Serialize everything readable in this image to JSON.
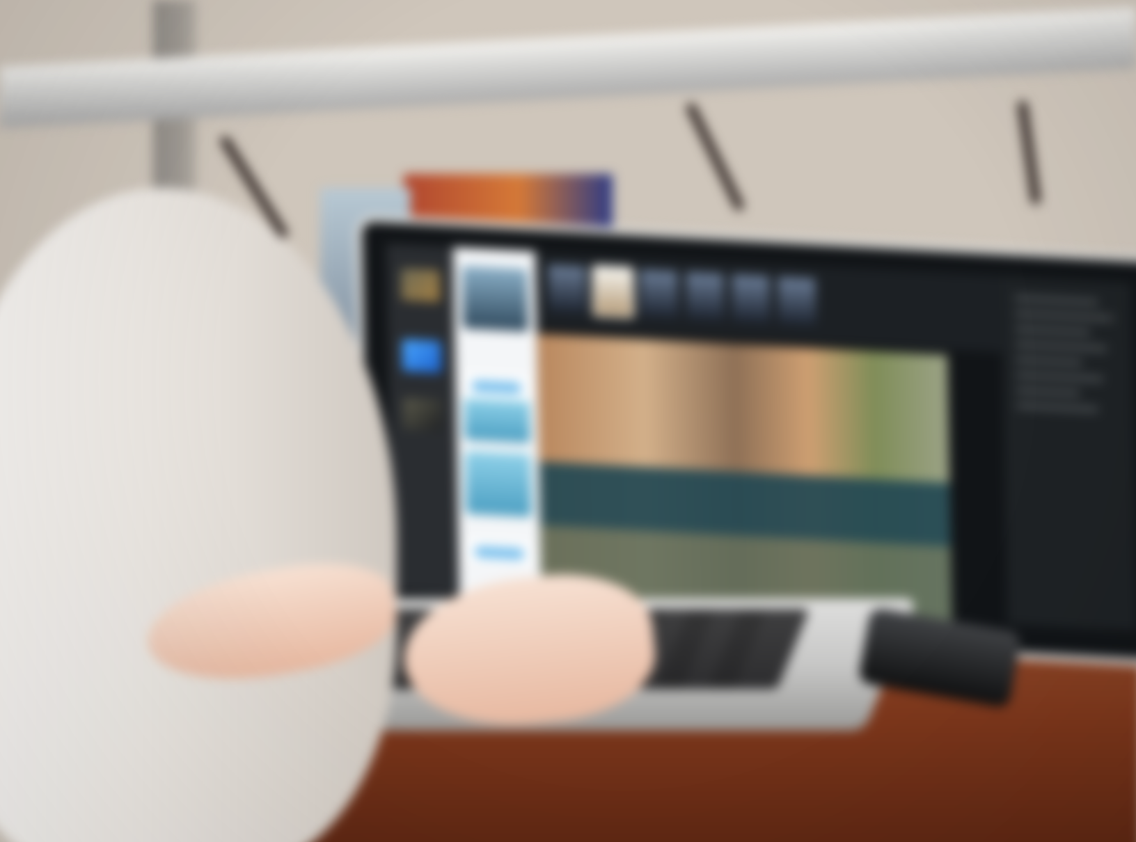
{
  "image": {
    "type": "blurred photograph of a person using a laptop with a photo-editing application"
  }
}
